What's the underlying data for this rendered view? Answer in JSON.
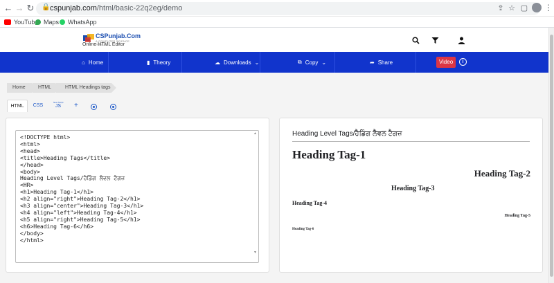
{
  "browser": {
    "url_host": "cspunjab.com",
    "url_path": "/html/basic-22q2eg/demo",
    "bookmarks": [
      {
        "label": "YouTube",
        "icon": "youtube-icon",
        "color": "#ff0000"
      },
      {
        "label": "Maps",
        "icon": "maps-icon",
        "color": "#34a853"
      },
      {
        "label": "WhatsApp",
        "icon": "whatsapp-icon",
        "color": "#25d366"
      }
    ]
  },
  "site": {
    "logo_text": "CSPunjab.Com",
    "logo_tagline": "A COMPUTER SCIENCE PORTAL",
    "subtitle": "Online HTML Editor",
    "brand_color": "#1134cc"
  },
  "nav": {
    "home": "Home",
    "theory": "Theory",
    "downloads": "Downloads",
    "copy": "Copy",
    "share": "Share",
    "video": "Video"
  },
  "breadcrumb": [
    "Home",
    "HTML",
    "HTML Headings tags"
  ],
  "tabs": {
    "html": "HTML",
    "css": "CSS",
    "js": "JS",
    "js_sup": "New Script",
    "plus": "+"
  },
  "editor": {
    "code": "<!DOCTYPE html>\n<html>\n<head>\n<title>Heading Tags</title>\n</head>\n<body>\nHeading Level Tags/ਹੈਡਿੰਗ ਲੈਵਲ ਟੈਗਜ਼\n<HR>\n<h1>Heading Tag-1</h1>\n<h2 align=\"right\">Heading Tag-2</h1>\n<h3 align=\"center\">Heading Tag-3</h1>\n<h4 align=\"left\">Heading Tag-4</h1>\n<h5 align=\"right\">Heading Tag-5</h1>\n<h6>Heading Tag-6</h6>\n</body>\n</html>"
  },
  "preview": {
    "intro": "Heading Level Tags/ਹੈਡਿੰਗ ਲੈਵਲ ਟੈਗਜ਼",
    "h1": "Heading Tag-1",
    "h2": "Heading Tag-2",
    "h3": "Heading Tag-3",
    "h4": "Heading Tag-4",
    "h5": "Heading Tag-5",
    "h6": "Heading Tag-6"
  }
}
